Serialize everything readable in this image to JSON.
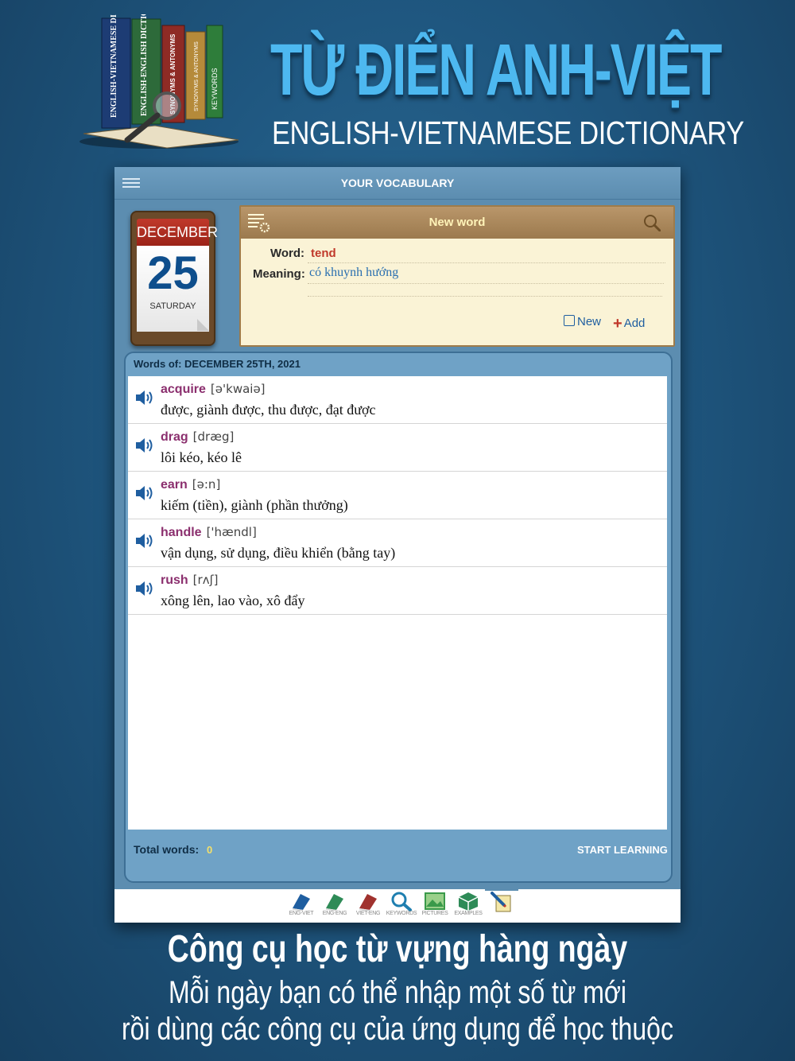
{
  "promo": {
    "title": "TỪ ĐIỂN ANH-VIỆT",
    "subtitle": "ENGLISH-VIETNAMESE DICTIONARY",
    "book_spines": [
      "ENGLISH-VIETNAMESE DICTIONARY",
      "ENGLISH-ENGLISH DICTIONARY",
      "SYNONYMS & ANTONYMS",
      "SYNONYMS & ANTONYMS",
      "KEYWORDS"
    ],
    "caption_line1": "Công cụ học từ vựng hàng ngày",
    "caption_line2": "Mỗi ngày bạn có thể nhập một số từ mới",
    "caption_line3": "rồi dùng các công cụ của ứng dụng để học thuộc"
  },
  "nav": {
    "title": "YOUR VOCABULARY",
    "menu_icon": "hamburger-icon"
  },
  "calendar": {
    "month": "DECEMBER",
    "day": "25",
    "weekday": "SATURDAY"
  },
  "new_word": {
    "title": "New word",
    "word_label": "Word:",
    "word_value": "tend",
    "meaning_label": "Meaning:",
    "meaning_value": "có khuynh hướng",
    "new_label": "New",
    "add_label": "Add"
  },
  "words": {
    "header": "Words of: DECEMBER 25TH, 2021",
    "items": [
      {
        "word": "acquire",
        "pron": "[ə'kwaiə]",
        "meaning": "được, giành được, thu được, đạt được"
      },
      {
        "word": "drag",
        "pron": "[dræg]",
        "meaning": "lôi kéo, kéo lê"
      },
      {
        "word": "earn",
        "pron": "[ə:n]",
        "meaning": "kiếm (tiền), giành (phần thưởng)"
      },
      {
        "word": "handle",
        "pron": "['hændl]",
        "meaning": "vận dụng, sử dụng, điều khiển (bằng tay)"
      },
      {
        "word": "rush",
        "pron": "[rʌʃ]",
        "meaning": "xông lên, lao vào, xô đẩy"
      }
    ],
    "total_label": "Total words:",
    "total_value": "0",
    "start_label": "START LEARNING"
  },
  "tabs": [
    {
      "label": "ENG-VIET",
      "color": "#1f5ea0"
    },
    {
      "label": "ENG-ENG",
      "color": "#2e8b57"
    },
    {
      "label": "VIET-ENG",
      "color": "#a0322e"
    },
    {
      "label": "KEYWORDS",
      "color": "#1f7fb0"
    },
    {
      "label": "PICTURES",
      "color": "#3a9a4a"
    },
    {
      "label": "EXAMPLES",
      "color": "#2e8b57"
    },
    {
      "label": "",
      "color": "#1f5ea0"
    }
  ],
  "colors": {
    "background": "#1f5780",
    "title_blue": "#4db8f0",
    "panel": "#5c8db0",
    "word_purple": "#8b2f6e",
    "accent_red": "#c0392b"
  }
}
